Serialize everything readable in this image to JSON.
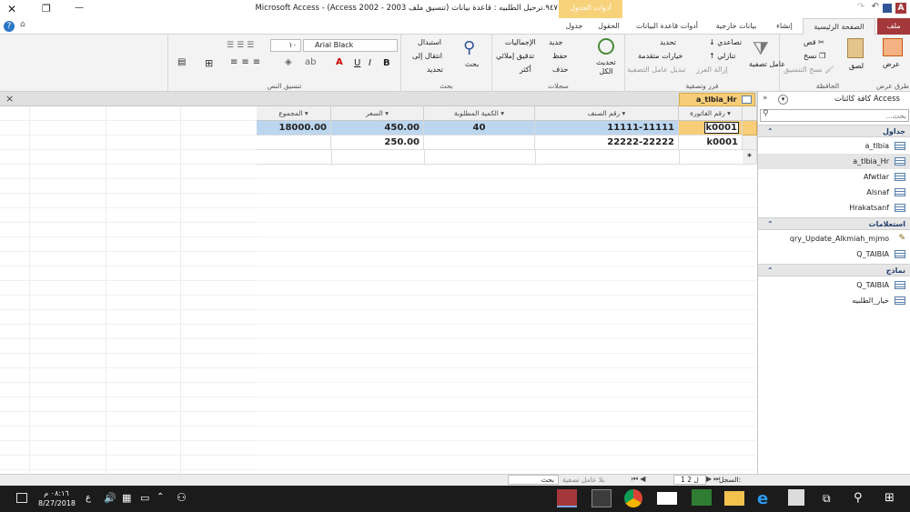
{
  "window": {
    "title": "٩٤٧.ترحيل الطلبيه : قاعدة بيانات (تنسيق ملف 2003 - Access 2002) - Microsoft Access",
    "context_tab": "أدوات الجدول",
    "minimize": "—",
    "restore": "❐",
    "close": "✕"
  },
  "ribbon_tabs": [
    "ملف",
    "الصفحة الرئيسية",
    "إنشاء",
    "بيانات خارجية",
    "أدوات قاعدة البيانات",
    "الحقول",
    "جدول"
  ],
  "ribbon": {
    "views": {
      "label": "طرق عرض",
      "btn": "عرض"
    },
    "clipboard": {
      "label": "الحافظة",
      "paste": "لصق",
      "cut": "قص",
      "copy": "نسخ",
      "format_painter": "نسخ التنسيق"
    },
    "sort": {
      "label": "فرز وتصفية",
      "filter": "عامل تصفية",
      "asc": "تصاعدي",
      "desc": "تنازلي",
      "remove_sort": "إزالة الفرز",
      "selection": "تحديد",
      "advanced": "خيارات متقدمة",
      "toggle": "تبديل عامل التصفية"
    },
    "records": {
      "label": "سجلات",
      "refresh": "تحديث الكل",
      "new": "جديد",
      "save": "حفظ",
      "delete": "حذف",
      "totals": "الإجماليات",
      "spelling": "تدقيق إملائي",
      "more": "أكثر"
    },
    "find": {
      "label": "بحث",
      "find": "بحث",
      "replace": "استبدال",
      "goto": "انتقال إلى",
      "select": "تحديد"
    },
    "text": {
      "label": "تنسيق النص",
      "font": "Arial Black",
      "size": "١٠"
    }
  },
  "document": {
    "tab_label": "a_tlbia_Hr",
    "close": "×"
  },
  "table": {
    "columns": [
      "رقم الفاتورة",
      "رقم الصنف",
      "الكمية المطلوبة",
      "السعر",
      "المجموع"
    ],
    "rows": [
      {
        "invoice": "k0001",
        "item": "11111-11111",
        "qty": "40",
        "price": "450.00",
        "total": "18000.00"
      },
      {
        "invoice": "k0001",
        "item": "22222-22222",
        "qty": "",
        "price": "250.00",
        "total": ""
      }
    ],
    "new_row_marker": "*"
  },
  "nav": {
    "title": "كافة كائنات Access",
    "search_placeholder": "بحث...",
    "sections": [
      {
        "name": "جداول",
        "items": [
          "a_tlbia",
          "a_tlbia_Hr",
          "Afwtlar",
          "Alsnaf",
          "Hrakatsanf"
        ]
      },
      {
        "name": "استعلامات",
        "items": [
          "qry_Update_Alkmiah_mjmo",
          "Q_TAIBIA"
        ]
      },
      {
        "name": "نماذج",
        "items": [
          "Q_TAIBIA",
          "خيار_الطلبيه"
        ]
      }
    ]
  },
  "status": {
    "record_label": "السجل:",
    "record_value": "1 ل 2",
    "nofilter": "بلا عامل تصفية",
    "search": "بحث"
  },
  "taskbar": {
    "time": "٠٨:١٦ م",
    "date": "8/27/2018",
    "lang": "ع"
  }
}
